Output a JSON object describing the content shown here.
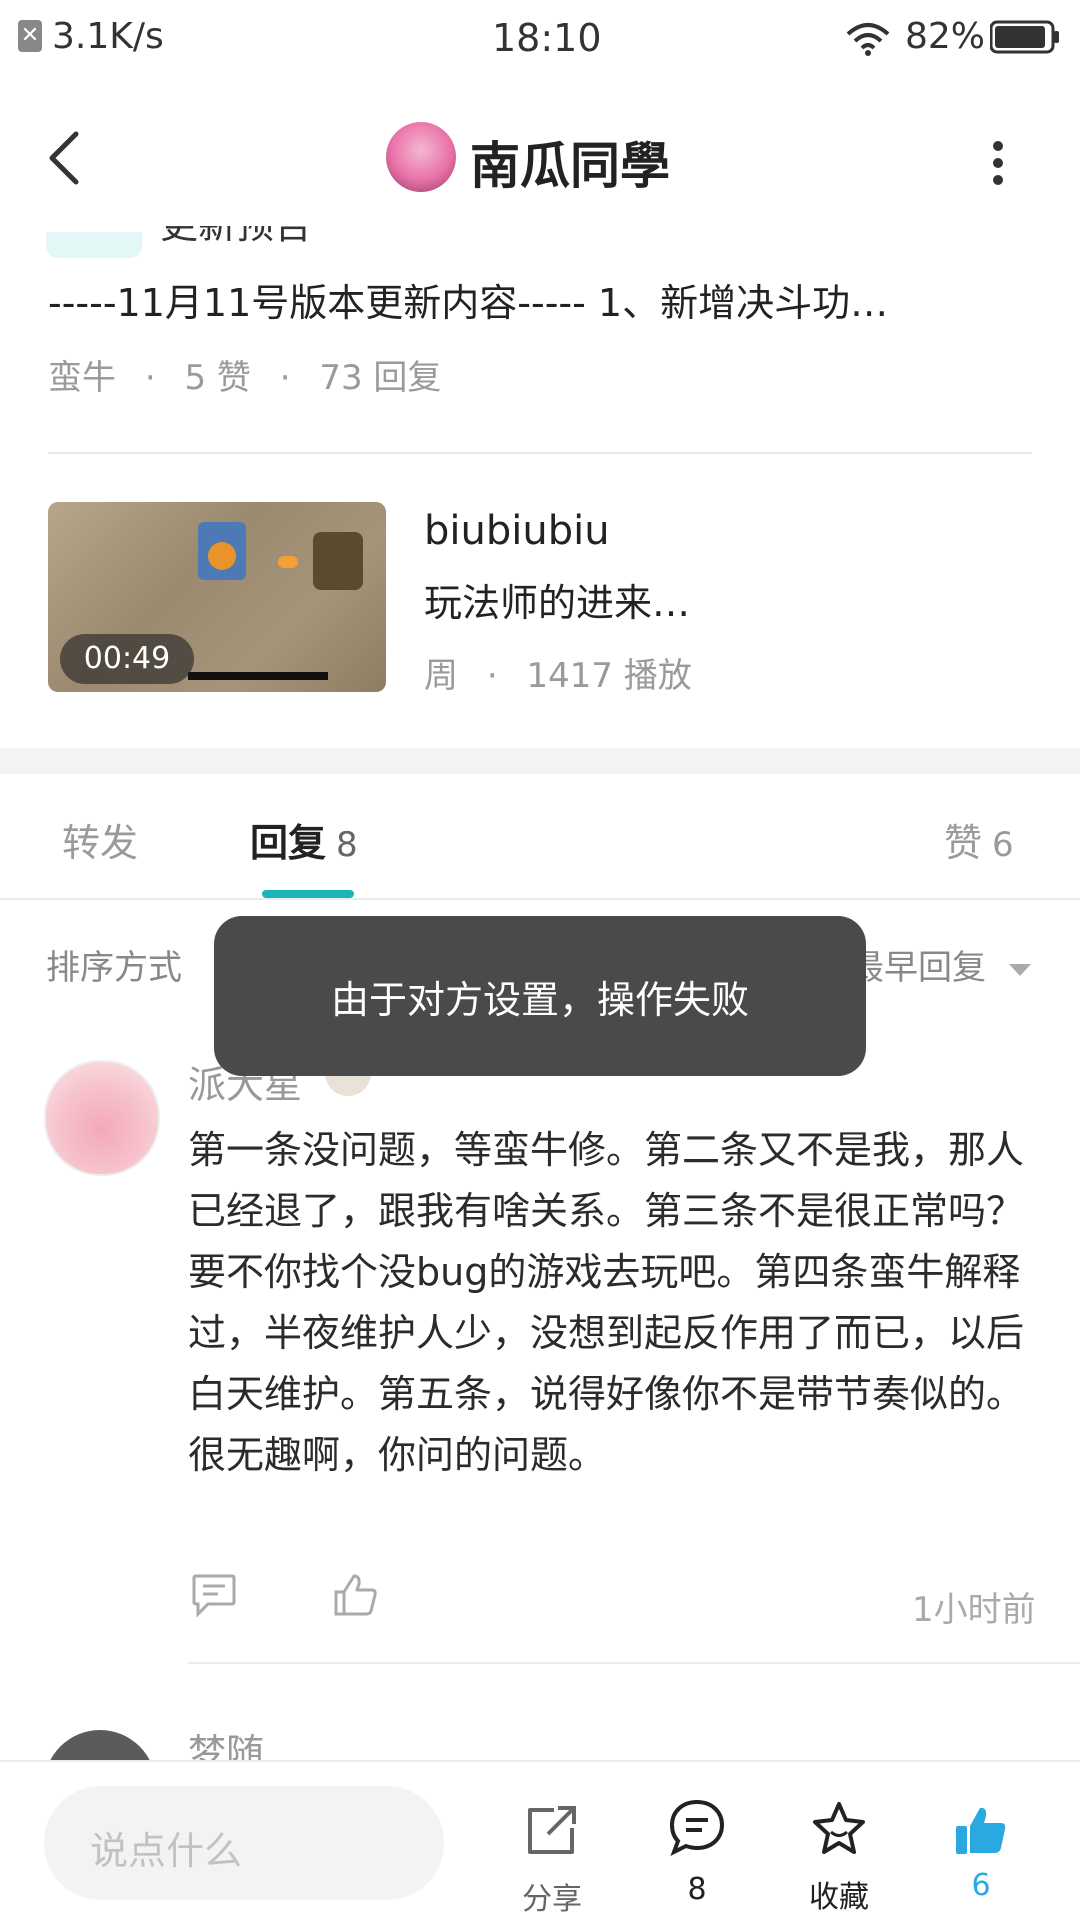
{
  "status_bar": {
    "net_speed": "3.1K/s",
    "time": "18:10",
    "battery": "82%"
  },
  "header": {
    "title": "南瓜同學"
  },
  "post": {
    "partial_header": "更新预告",
    "text": "-----11月11号版本更新内容----- 1、新增决斗功…",
    "meta": [
      "蛮牛",
      "5 赞",
      "73 回复"
    ]
  },
  "video": {
    "duration": "00:49",
    "title": "biubiubiu",
    "desc": "玩法师的进来…",
    "meta": [
      "周",
      "1417 播放"
    ]
  },
  "tabs": [
    {
      "label": "转发",
      "count": ""
    },
    {
      "label": "回复",
      "count": "8"
    },
    {
      "label": "赞",
      "count": "6"
    }
  ],
  "sort": {
    "label": "排序方式",
    "value": "最早回复"
  },
  "toast": "由于对方设置，操作失败",
  "comments": [
    {
      "author": "派大星",
      "text": "第一条没问题，等蛮牛修。第二条又不是我，那人已经退了，跟我有啥关系。第三条不是很正常吗？要不你找个没bug的游戏去玩吧。第四条蛮牛解释过，半夜维护人少，没想到起反作用了而已，以后白天维护。第五条，说得好像你不是带节奏似的。很无趣啊，你问的问题。",
      "time": "1小时前"
    },
    {
      "author": "梦随"
    }
  ],
  "bottom_bar": {
    "placeholder": "说点什么",
    "share": "分享",
    "reply_count": "8",
    "favorite": "收藏",
    "like_count": "6"
  },
  "colors": {
    "accent": "#1bb5b5",
    "like_blue": "#2aa8e0",
    "toast_bg": "#4a4a4a"
  }
}
